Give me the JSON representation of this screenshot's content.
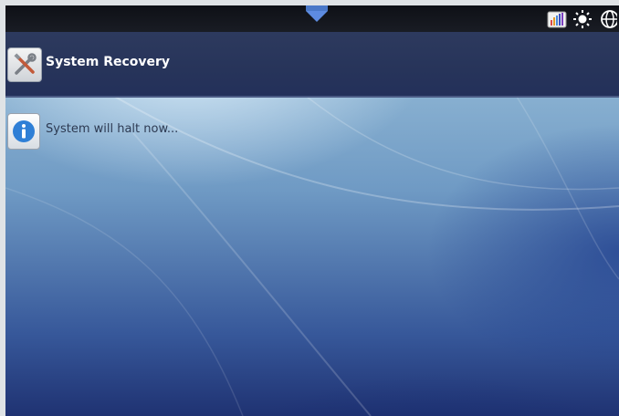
{
  "statusbar": {
    "tray_icons": [
      "signal-bars-icon",
      "brightness-icon",
      "globe-icon"
    ]
  },
  "header": {
    "title": "System Recovery",
    "icon": "tools-icon"
  },
  "message": {
    "text": "System will halt now...",
    "icon": "info-icon"
  },
  "colors": {
    "titlebar": "#27345a",
    "topbar": "#13161d",
    "pulldown": "#4a78c8",
    "info_blue": "#2f7fd6"
  }
}
